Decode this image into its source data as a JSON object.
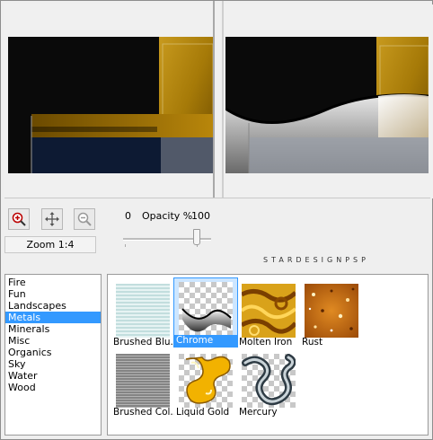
{
  "zoom": {
    "label": "Zoom 1:4"
  },
  "opacity": {
    "min_label": "0",
    "label": "Opacity %",
    "max_label": "100",
    "value": 100
  },
  "watermark": "STARDESIGNPSP",
  "categories": {
    "items": [
      "Fire",
      "Fun",
      "Landscapes",
      "Metals",
      "Minerals",
      "Misc",
      "Organics",
      "Sky",
      "Water",
      "Wood"
    ],
    "selected": "Metals"
  },
  "swatches": {
    "selected": "Chrome",
    "items": [
      {
        "label": "Brushed Blu..."
      },
      {
        "label": "Chrome"
      },
      {
        "label": "Molten Iron"
      },
      {
        "label": "Rust"
      },
      {
        "label": "Brushed Col..."
      },
      {
        "label": "Liquid Gold"
      },
      {
        "label": "Mercury"
      }
    ]
  },
  "colors": {
    "selection": "#3399ff",
    "gold": "#b8860b",
    "navy": "#0d1a33"
  }
}
